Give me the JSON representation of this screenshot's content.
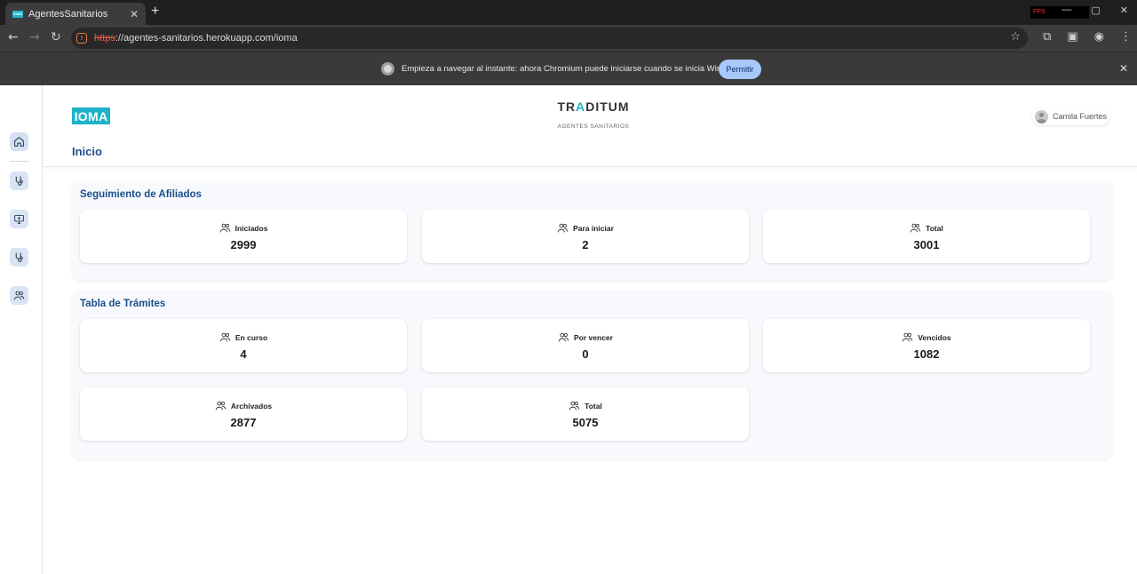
{
  "browser": {
    "tab_title": "AgentesSanitarios",
    "tab_favicon_text": "IOMA",
    "tab_close": "✕",
    "new_tab": "+",
    "fps_label": "FPS",
    "url_scheme": "https",
    "url_rest": "://agentes-sanitarios.herokuapp.com/ioma",
    "window_controls": [
      "—",
      "▢",
      "✕"
    ]
  },
  "infobar": {
    "message": "Empieza a navegar al instante: ahora Chromium puede iniciarse cuando se inicia Windows.",
    "allow_button": "Permitir",
    "close": "✕"
  },
  "header": {
    "logo": "IOMA",
    "brand_pre": "TR",
    "brand_accent": "A",
    "brand_post": "DITUM",
    "brand_sub": "AGENTES SANITARIOS",
    "user_name": "Camila Fuertes",
    "page_title": "Inicio"
  },
  "sidebar": {
    "items": [
      "home-icon",
      "stethoscope-icon",
      "monitor-plus-icon",
      "stethoscope-icon",
      "users-icon"
    ]
  },
  "seguimiento": {
    "title": "Seguimiento de Afiliados",
    "cards": [
      {
        "label": "Iniciados",
        "value": "2999"
      },
      {
        "label": "Para iniciar",
        "value": "2"
      },
      {
        "label": "Total",
        "value": "3001"
      }
    ]
  },
  "tramites": {
    "title": "Tabla de Trámites",
    "cards": [
      {
        "label": "En curso",
        "value": "4"
      },
      {
        "label": "Por vencer",
        "value": "0"
      },
      {
        "label": "Vencidos",
        "value": "1082"
      },
      {
        "label": "Archivados",
        "value": "2877"
      },
      {
        "label": "Total",
        "value": "5075"
      }
    ]
  },
  "colors": {
    "accent": "#1fb2c8",
    "title_blue": "#1b4f8c",
    "sidebar_btn": "#d9e5f5",
    "allow_btn": "#a8c7fa"
  }
}
